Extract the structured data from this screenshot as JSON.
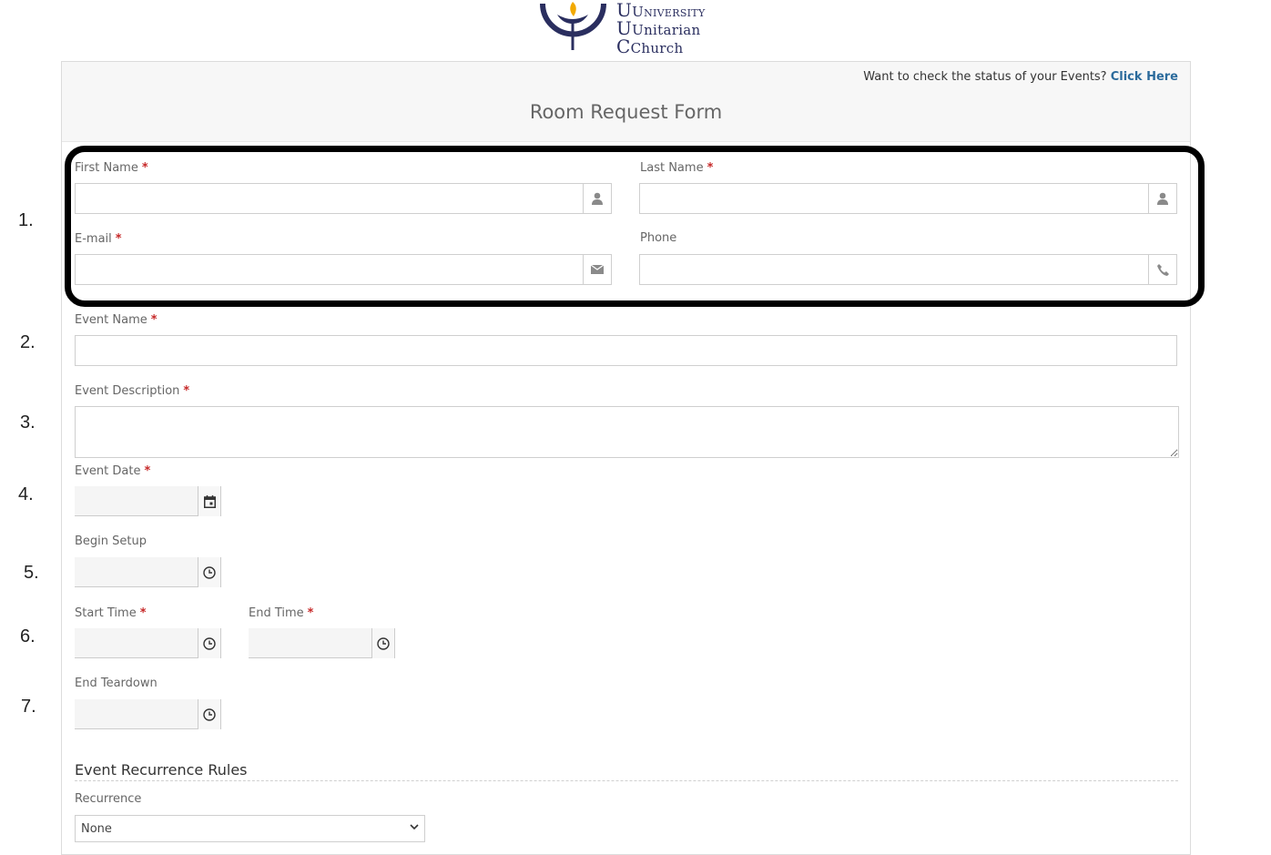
{
  "logo": {
    "line1": "University",
    "line2": "Unitarian",
    "line3": "Church"
  },
  "header": {
    "status_prompt": "Want to check the status of your Events?",
    "status_link": "Click Here",
    "title": "Room Request Form"
  },
  "steps": [
    "1.",
    "2.",
    "3.",
    "4.",
    "5.",
    "6.",
    "7."
  ],
  "fields": {
    "first_name": {
      "label": "First Name",
      "required": "*",
      "value": ""
    },
    "last_name": {
      "label": "Last Name",
      "required": "*",
      "value": ""
    },
    "email": {
      "label": "E-mail",
      "required": "*",
      "value": ""
    },
    "phone": {
      "label": "Phone",
      "value": ""
    },
    "event_name": {
      "label": "Event Name",
      "required": "*",
      "value": ""
    },
    "event_description": {
      "label": "Event Description",
      "required": "*",
      "value": ""
    },
    "event_date": {
      "label": "Event Date",
      "required": "*",
      "value": ""
    },
    "begin_setup": {
      "label": "Begin Setup",
      "value": ""
    },
    "start_time": {
      "label": "Start Time",
      "required": "*",
      "value": ""
    },
    "end_time": {
      "label": "End Time",
      "required": "*",
      "value": ""
    },
    "end_teardown": {
      "label": "End Teardown",
      "value": ""
    }
  },
  "recurrence": {
    "section_title": "Event Recurrence Rules",
    "label": "Recurrence",
    "selected": "None"
  },
  "colors": {
    "required": "#c62828",
    "link": "#2c6b9c",
    "logo": "#2a2e5f",
    "logo_flame": "#f2a900"
  },
  "icons": {
    "person": "person-icon",
    "envelope": "envelope-icon",
    "phone": "phone-icon",
    "calendar": "calendar-icon",
    "clock": "clock-icon",
    "chevron": "chevron-down-icon"
  }
}
